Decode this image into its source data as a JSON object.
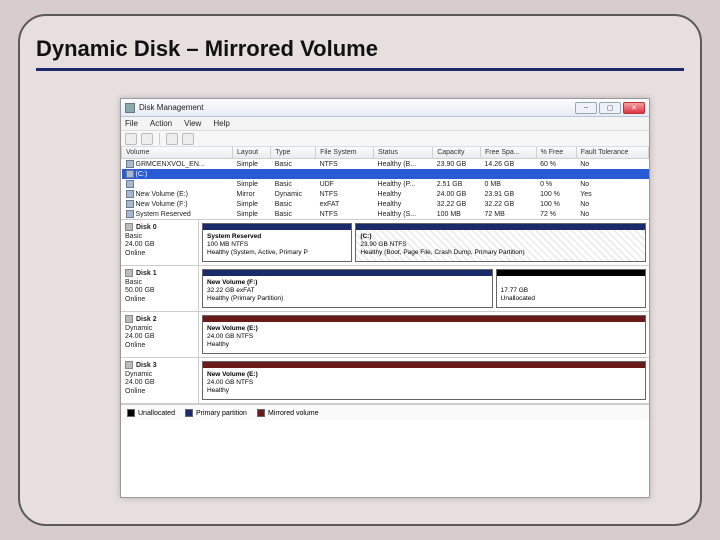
{
  "slide": {
    "title": "Dynamic Disk – Mirrored Volume"
  },
  "window": {
    "title": "Disk Management",
    "menus": [
      "File",
      "Action",
      "View",
      "Help"
    ]
  },
  "table": {
    "headers": [
      "Volume",
      "Layout",
      "Type",
      "File System",
      "Status",
      "Capacity",
      "Free Spa...",
      "% Free",
      "Fault Tolerance"
    ],
    "rows": [
      {
        "sel": false,
        "c": [
          "GRMCENXVOL_EN...",
          "Simple",
          "Basic",
          "NTFS",
          "Healthy (B...",
          "23.90 GB",
          "14.26 GB",
          "60 %",
          "No"
        ]
      },
      {
        "sel": true,
        "c": [
          "(C:)",
          "",
          "",
          "",
          "",
          "",
          "",
          "",
          ""
        ]
      },
      {
        "sel": false,
        "c": [
          "",
          "Simple",
          "Basic",
          "UDF",
          "Healthy (P...",
          "2.51 GB",
          "0 MB",
          "0 %",
          "No"
        ]
      },
      {
        "sel": false,
        "c": [
          "New Volume (E:)",
          "Mirror",
          "Dynamic",
          "NTFS",
          "Healthy",
          "24.00 GB",
          "23.91 GB",
          "100 %",
          "Yes"
        ]
      },
      {
        "sel": false,
        "c": [
          "New Volume (F:)",
          "Simple",
          "Basic",
          "exFAT",
          "Healthy",
          "32.22 GB",
          "32.22 GB",
          "100 %",
          "No"
        ]
      },
      {
        "sel": false,
        "c": [
          "System Reserved",
          "Simple",
          "Basic",
          "NTFS",
          "Healthy (S...",
          "100 MB",
          "72 MB",
          "72 %",
          "No"
        ]
      }
    ]
  },
  "disks": [
    {
      "label": "Disk 0",
      "type": "Basic",
      "size": "24.00 GB",
      "state": "Online",
      "parts": [
        {
          "stripe": "navy",
          "hatch": false,
          "grow": 1,
          "l1": "System Reserved",
          "l2": "100 MB NTFS",
          "l3": "Healthy (System, Active, Primary P"
        },
        {
          "stripe": "navy",
          "hatch": true,
          "grow": 2,
          "l1": "(C:)",
          "l2": "23.90 GB NTFS",
          "l3": "Healthy (Boot, Page File, Crash Dump, Primary Partition)"
        }
      ]
    },
    {
      "label": "Disk 1",
      "type": "Basic",
      "size": "50.00 GB",
      "state": "Online",
      "parts": [
        {
          "stripe": "navy",
          "hatch": false,
          "grow": 2,
          "l1": "New Volume (F:)",
          "l2": "32.22 GB exFAT",
          "l3": "Healthy (Primary Partition)"
        },
        {
          "stripe": "black",
          "hatch": false,
          "grow": 1,
          "l1": "",
          "l2": "17.77 GB",
          "l3": "Unallocated"
        }
      ]
    },
    {
      "label": "Disk 2",
      "type": "Dynamic",
      "size": "24.00 GB",
      "state": "Online",
      "parts": [
        {
          "stripe": "maroon",
          "hatch": false,
          "grow": 1,
          "l1": "New Volume (E:)",
          "l2": "24.00 GB NTFS",
          "l3": "Healthy"
        }
      ]
    },
    {
      "label": "Disk 3",
      "type": "Dynamic",
      "size": "24.00 GB",
      "state": "Online",
      "parts": [
        {
          "stripe": "maroon",
          "hatch": false,
          "grow": 1,
          "l1": "New Volume (E:)",
          "l2": "24.00 GB NTFS",
          "l3": "Healthy"
        }
      ]
    }
  ],
  "legend": [
    {
      "color": "#000",
      "label": "Unallocated"
    },
    {
      "color": "#1a2a6b",
      "label": "Primary partition"
    },
    {
      "color": "#6b1a1a",
      "label": "Mirrored volume"
    }
  ]
}
